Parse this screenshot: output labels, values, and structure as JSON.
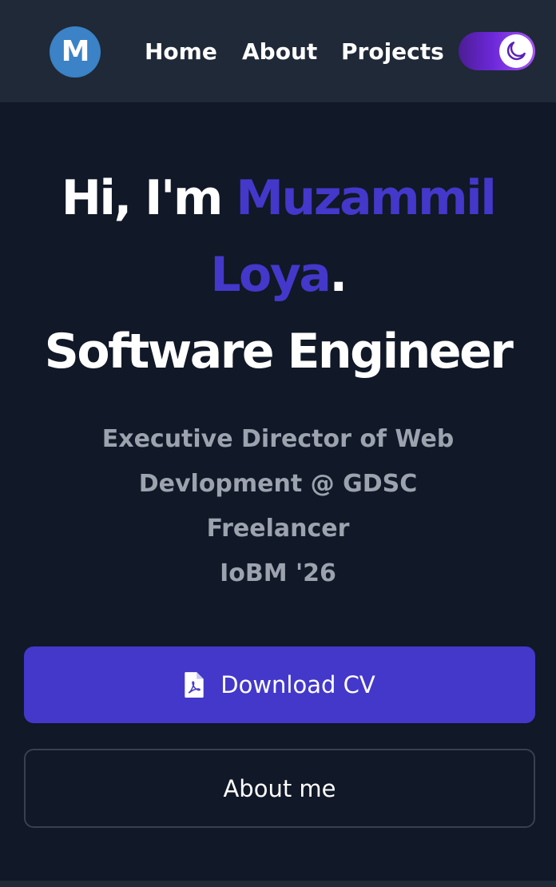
{
  "header": {
    "logo_letter": "M",
    "nav": {
      "home": "Home",
      "about": "About",
      "projects": "Projects"
    },
    "theme_toggle": {
      "mode": "dark",
      "icon": "moon-icon"
    }
  },
  "hero": {
    "greeting": "Hi, I'm",
    "name_first": "Muzammil",
    "name_last": "Loya",
    "period": ".",
    "role": "Software Engineer",
    "subtitle_lines": [
      "Executive Director of Web",
      "Devlopment @ GDSC",
      "Freelancer",
      "IoBM '26"
    ]
  },
  "buttons": {
    "download_cv": "Download CV",
    "download_icon": "pdf-file-icon",
    "about_me": "About me"
  },
  "colors": {
    "background": "#111827",
    "header": "#1f2937",
    "accent": "#4338ca",
    "logo": "#3b82c6",
    "subtitle": "#9ca3af"
  }
}
